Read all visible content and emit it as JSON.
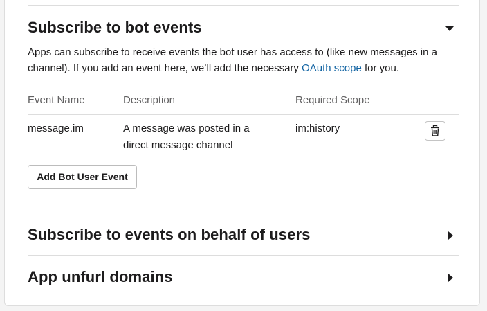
{
  "bot_events": {
    "title": "Subscribe to bot events",
    "description_before_link": "Apps can subscribe to receive events the bot user has access to (like new messages in a channel). If you add an event here, we’ll add the necessary ",
    "description_link": "OAuth scope",
    "description_after_link": " for you.",
    "columns": {
      "event_name": "Event Name",
      "description": "Description",
      "required_scope": "Required Scope"
    },
    "rows": [
      {
        "event_name": "message.im",
        "description": "A message was posted in a direct message channel",
        "required_scope": "im:history",
        "delete_icon": "trash-icon"
      }
    ],
    "add_button": "Add Bot User Event",
    "expanded_icon": "caret-down-icon"
  },
  "user_events": {
    "title": "Subscribe to events on behalf of users",
    "collapsed_icon": "caret-right-icon"
  },
  "unfurl_domains": {
    "title": "App unfurl domains",
    "collapsed_icon": "caret-right-icon"
  },
  "colors": {
    "link": "#1264a3",
    "text": "#1d1c1d",
    "muted": "#616061",
    "divider": "#dddddd"
  }
}
